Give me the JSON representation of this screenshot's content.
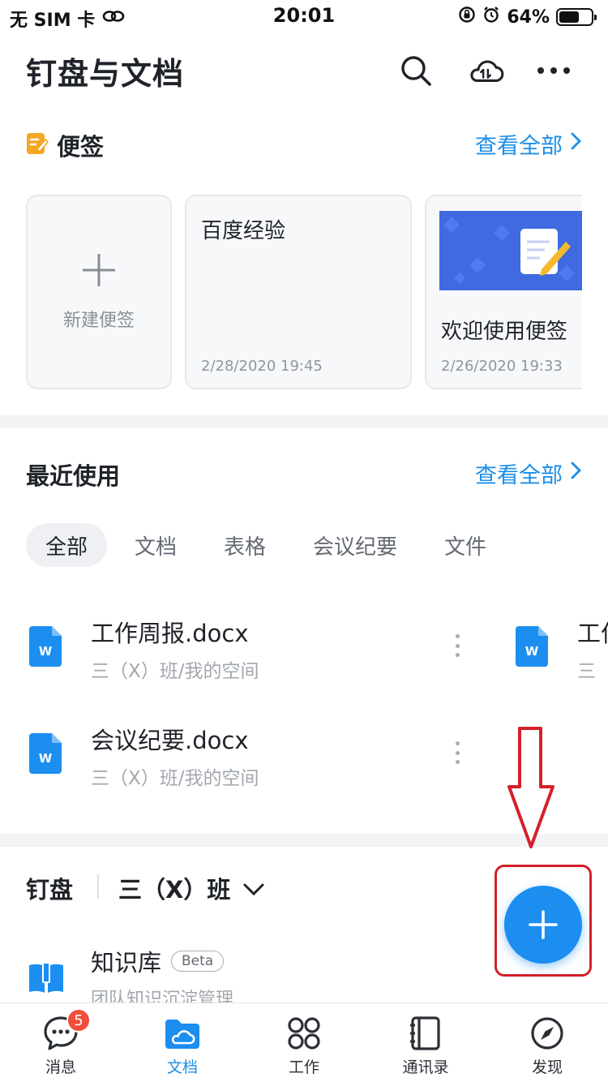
{
  "status_bar": {
    "carrier": "无 SIM 卡",
    "time": "20:01",
    "battery": "64%",
    "battery_level": 0.64
  },
  "header": {
    "title": "钉盘与文档"
  },
  "notes": {
    "title": "便签",
    "see_all": "查看全部",
    "new_label": "新建便签",
    "items": [
      {
        "title": "百度经验",
        "date": "2/28/2020 19:45"
      },
      {
        "title": "欢迎使用便签",
        "date": "2/26/2020 19:33"
      }
    ]
  },
  "recent": {
    "title": "最近使用",
    "see_all": "查看全部",
    "tabs": [
      "全部",
      "文档",
      "表格",
      "会议纪要",
      "文件"
    ],
    "files": [
      {
        "name": "工作周报.docx",
        "path": "三（X）班/我的空间"
      },
      {
        "name": "会议纪要.docx",
        "path": "三（X）班/我的空间"
      }
    ],
    "peek": {
      "name": "工作",
      "path": "三"
    }
  },
  "drive": {
    "title": "钉盘",
    "space": "三（X）班",
    "kb_title": "知识库",
    "kb_badge": "Beta",
    "kb_sub": "团队知识沉淀管理"
  },
  "bottom_nav": [
    {
      "label": "消息",
      "badge": "5"
    },
    {
      "label": "文档"
    },
    {
      "label": "工作"
    },
    {
      "label": "通讯录"
    },
    {
      "label": "发现"
    }
  ],
  "colors": {
    "accent": "#1b8ee8",
    "annotation": "#d4202a",
    "note_icon": "#f5a623"
  }
}
